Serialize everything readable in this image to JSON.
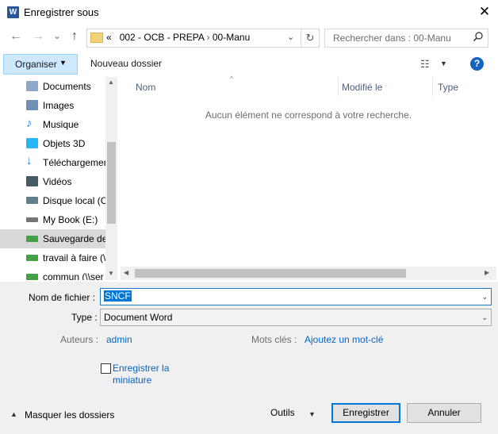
{
  "window": {
    "title": "Enregistrer sous",
    "app_icon_letter": "W",
    "close_glyph": "✕"
  },
  "nav": {
    "back": "←",
    "forward": "→",
    "history": "⌄",
    "up": "↑",
    "breadcrumb": [
      "002 - OCB - PREPA",
      "00-Manu"
    ],
    "breadcrumb_prefix": "«",
    "breadcrumb_sep": "›",
    "address_caret": "⌄",
    "refresh": "↻",
    "search_placeholder": "Rechercher dans : 00-Manu"
  },
  "toolbar": {
    "organiser": "Organiser",
    "new_folder": "Nouveau dossier",
    "view_glyph": "☷",
    "help_glyph": "?"
  },
  "sidebar": {
    "items": [
      {
        "label": "Documents",
        "icon": "documents-icon",
        "color": "#8fa8c8",
        "selected": false
      },
      {
        "label": "Images",
        "icon": "images-icon",
        "color": "#6f8fb6",
        "selected": false
      },
      {
        "label": "Musique",
        "icon": "music-icon",
        "color": "#1e88e5",
        "selected": false
      },
      {
        "label": "Objets 3D",
        "icon": "objects-3d-icon",
        "color": "#29b6f6",
        "selected": false
      },
      {
        "label": "Téléchargements",
        "icon": "downloads-icon",
        "color": "#1976d2",
        "selected": false
      },
      {
        "label": "Vidéos",
        "icon": "videos-icon",
        "color": "#455a64",
        "selected": false
      },
      {
        "label": "Disque local (C:)",
        "icon": "local-disk-icon",
        "color": "#607d8b",
        "selected": false
      },
      {
        "label": "My Book (E:)",
        "icon": "drive-icon",
        "color": "#757575",
        "selected": false
      },
      {
        "label": "Sauvegarde des",
        "icon": "network-drive-icon",
        "color": "#43a047",
        "selected": true
      },
      {
        "label": "travail à faire (\\\\",
        "icon": "network-drive-icon",
        "color": "#43a047",
        "selected": false
      },
      {
        "label": "commun (\\\\ser",
        "icon": "network-drive-icon",
        "color": "#43a047",
        "selected": false
      }
    ]
  },
  "content": {
    "columns": [
      "Nom",
      "Modifié le",
      "Type"
    ],
    "empty_message": "Aucun élément ne correspond à votre recherche."
  },
  "form": {
    "filename_label": "Nom de fichier :",
    "filename_value": "SNCF",
    "type_label": "Type :",
    "type_value": "Document Word",
    "authors_label": "Auteurs :",
    "authors_value": "admin",
    "keywords_label": "Mots clés :",
    "keywords_value": "Ajoutez un mot-clé",
    "thumbnail_line1": "Enregistrer la",
    "thumbnail_line2": "miniature"
  },
  "footer": {
    "hide_folders": "Masquer les dossiers",
    "tools": "Outils",
    "save": "Enregistrer",
    "cancel": "Annuler"
  },
  "colors": {
    "accent": "#0078d7",
    "link": "#0066cc",
    "selection": "#cde8ff"
  }
}
